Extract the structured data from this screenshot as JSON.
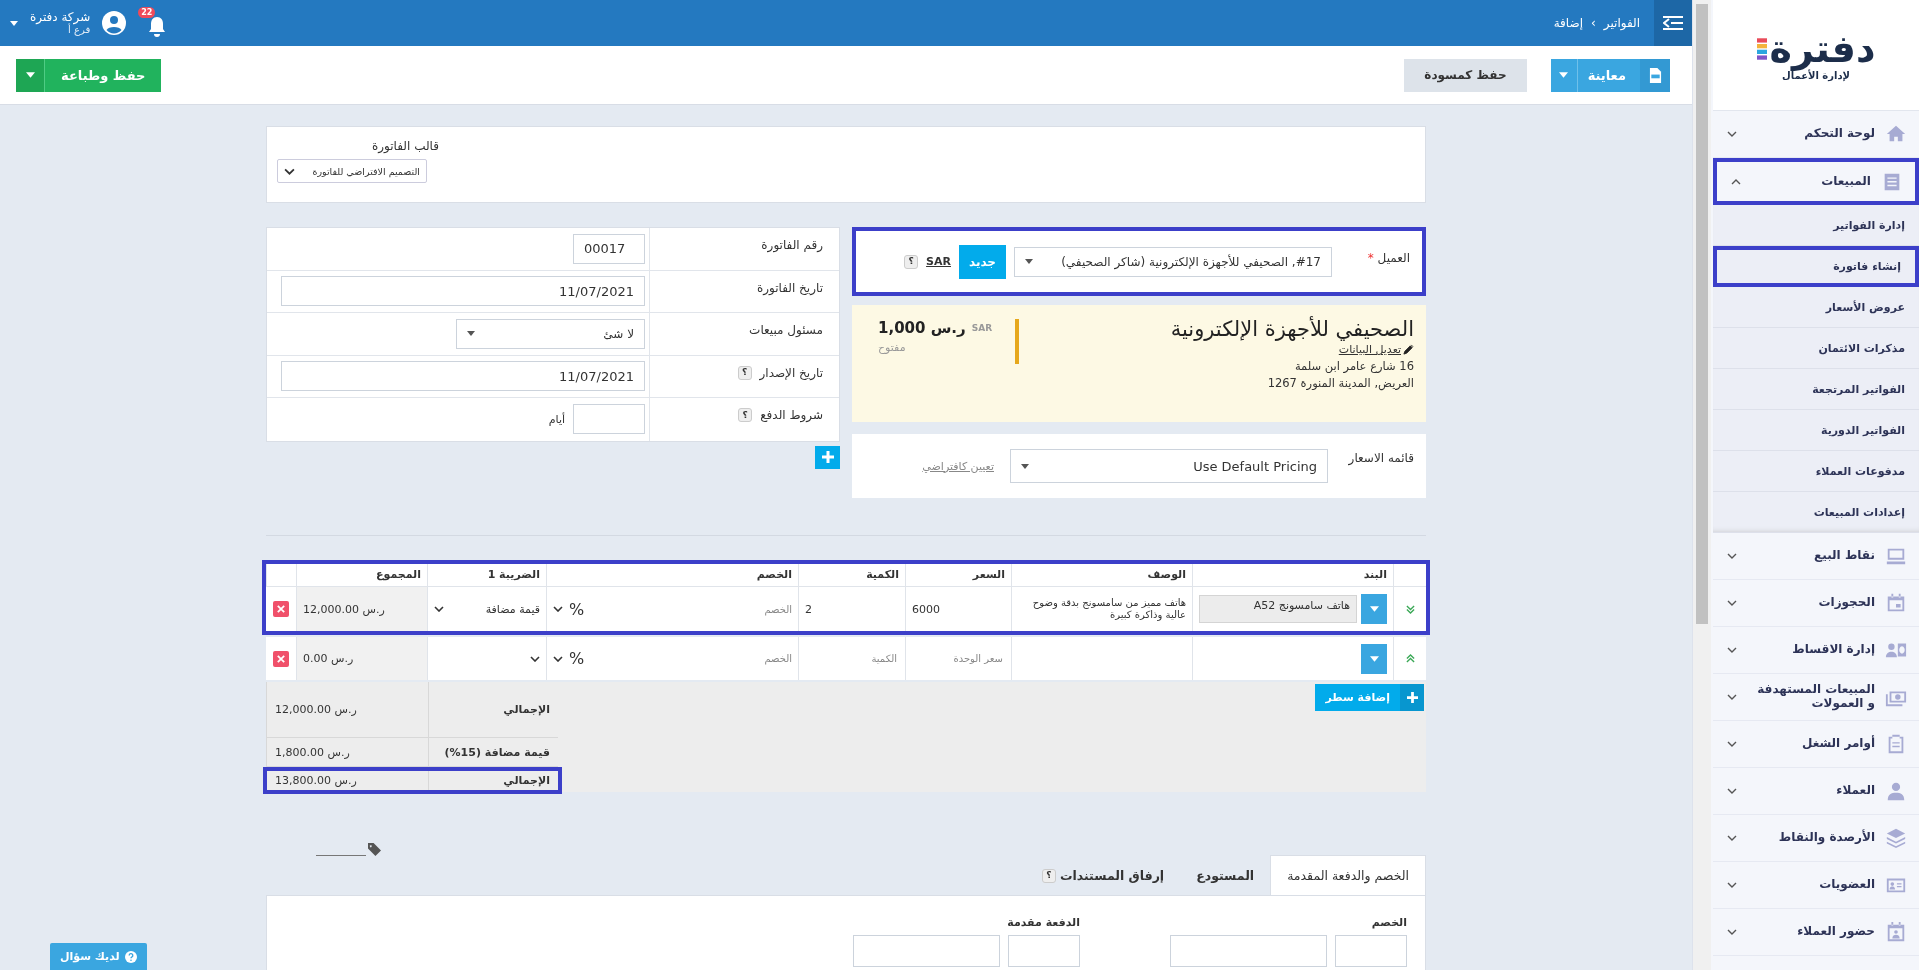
{
  "sidebar": {
    "logo_text": "دفترة",
    "logo_tagline": "لإدارة الأعمال",
    "items": [
      {
        "label": "لوحة التحكم",
        "kind": "home",
        "expanded": false,
        "highlighted": false
      },
      {
        "label": "المبيعات",
        "kind": "list",
        "expanded": true,
        "highlighted": true,
        "children": [
          {
            "label": "إدارة الفواتير",
            "highlighted": false
          },
          {
            "label": "إنشاء فاتورة",
            "highlighted": true
          },
          {
            "label": "عروض الأسعار",
            "highlighted": false
          },
          {
            "label": "مذكرات الائتمان",
            "highlighted": false
          },
          {
            "label": "الفواتير المرتجعة",
            "highlighted": false
          },
          {
            "label": "الفواتير الدورية",
            "highlighted": false
          },
          {
            "label": "مدفوعات العملاء",
            "highlighted": false
          },
          {
            "label": "إعدادات المبيعات",
            "highlighted": false
          }
        ]
      },
      {
        "label": "نقاط البيع",
        "kind": "pos",
        "expanded": false,
        "highlighted": false
      },
      {
        "label": "الحجوزات",
        "kind": "calendar",
        "expanded": false,
        "highlighted": false
      },
      {
        "label": "إدارة الاقساط",
        "kind": "installments",
        "expanded": false,
        "highlighted": false
      },
      {
        "label": "المبيعات المستهدفة و العمولات",
        "kind": "money",
        "expanded": false,
        "highlighted": false
      },
      {
        "label": "أوامر الشغل",
        "kind": "clipboard",
        "expanded": false,
        "highlighted": false
      },
      {
        "label": "العملاء",
        "kind": "person",
        "expanded": false,
        "highlighted": false
      },
      {
        "label": "الأرصدة والنقاط",
        "kind": "layers",
        "expanded": false,
        "highlighted": false
      },
      {
        "label": "العضويات",
        "kind": "idcard",
        "expanded": false,
        "highlighted": false
      },
      {
        "label": "حضور العملاء",
        "kind": "attendance",
        "expanded": false,
        "highlighted": false
      }
    ]
  },
  "top_bar": {
    "breadcrumb": [
      "الفواتير",
      "إضافة"
    ],
    "breadcrumb_separator": "›",
    "notifications": "22",
    "company": "شركة دفترة",
    "branch": "فرع أ"
  },
  "actions": {
    "preview": "معاينة",
    "draft": "حفظ كمسودة",
    "save_print": "حفظ وطباعة"
  },
  "template": {
    "label": "قالب الفاتورة",
    "value": "التصميم الافتراضي للفاتورة"
  },
  "invoice_fields": [
    {
      "label": "رقم الفاتورة",
      "kind": "short",
      "value": "00017"
    },
    {
      "label": "تاريخ الفاتورة",
      "kind": "date",
      "value": "11/07/2021"
    },
    {
      "label": "مسئول مبيعات",
      "kind": "select",
      "value": "لا شئ"
    },
    {
      "label": "تاريخ الإصدار",
      "kind": "date",
      "help": "؟",
      "value": "11/07/2021"
    },
    {
      "label": "شروط الدفع",
      "kind": "days",
      "help": "؟",
      "suffix": "أيام"
    }
  ],
  "client": {
    "label": "العميل",
    "required": "*",
    "value": "#17, الصحيفي للأجهزة الإلكترونية (شاكر الصحيفي)",
    "new_button": "جديد",
    "currency": "SAR",
    "help": "؟",
    "highlighted": true
  },
  "client_card": {
    "name": "الصحيفي للأجهزة الإلكترونية",
    "edit": "تعديل البيانات",
    "address": [
      "16 شارع عامر ابن سلمة",
      "العريض, المدينة المنورة 1267"
    ],
    "balance_currency": "SAR",
    "balance": "1,000 ر.س",
    "status": "مفتوح"
  },
  "pricing": {
    "label": "قائمه الاسعار",
    "value": "Use Default Pricing",
    "set_default": "تعيين كافتراضي"
  },
  "items_table": {
    "columns": [
      "البند",
      "الوصف",
      "السعر",
      "الكمية",
      "الخصم",
      "الضريبة 1",
      "المجموع"
    ],
    "rows": [
      {
        "expanded": false,
        "highlighted": true,
        "item": "هاتف سامسونج A52",
        "description": "هاتف مميز من سامسونج بدقة وضوح عالية وذاكرة كبيرة",
        "price": "6000",
        "quantity": "2",
        "discount_placeholder": "الخصم",
        "discount_type": "%",
        "tax": "قيمة مضافة",
        "total": "12,000.00 ر.س"
      },
      {
        "expanded": true,
        "highlighted": false,
        "price_placeholder": "سعر الوحدة",
        "quantity_placeholder": "الكمية",
        "discount_placeholder": "الخصم",
        "discount_type": "%",
        "total": "0.00 ر.س"
      }
    ],
    "add_row": "إضافة سطر",
    "totals": [
      {
        "label": "الإجمالي",
        "value": "12,000.00 ر.س",
        "highlighted": false
      },
      {
        "label": "قيمة مضافة (15%)",
        "value": "1,800.00 ر.س",
        "highlighted": false
      },
      {
        "label": "الإجمالي",
        "value": "13,800.00 ر.س",
        "highlighted": true
      }
    ]
  },
  "tabs": [
    {
      "label": "الخصم والدفعة المقدمة",
      "selected": true
    },
    {
      "label": "المستودع",
      "selected": false
    },
    {
      "label": "إرفاق المستندات",
      "help": "؟",
      "selected": false
    }
  ],
  "tab_panel": {
    "fields": [
      "الخصم",
      "الدفعة مقدمة"
    ]
  },
  "help_button": "لديك سؤال"
}
